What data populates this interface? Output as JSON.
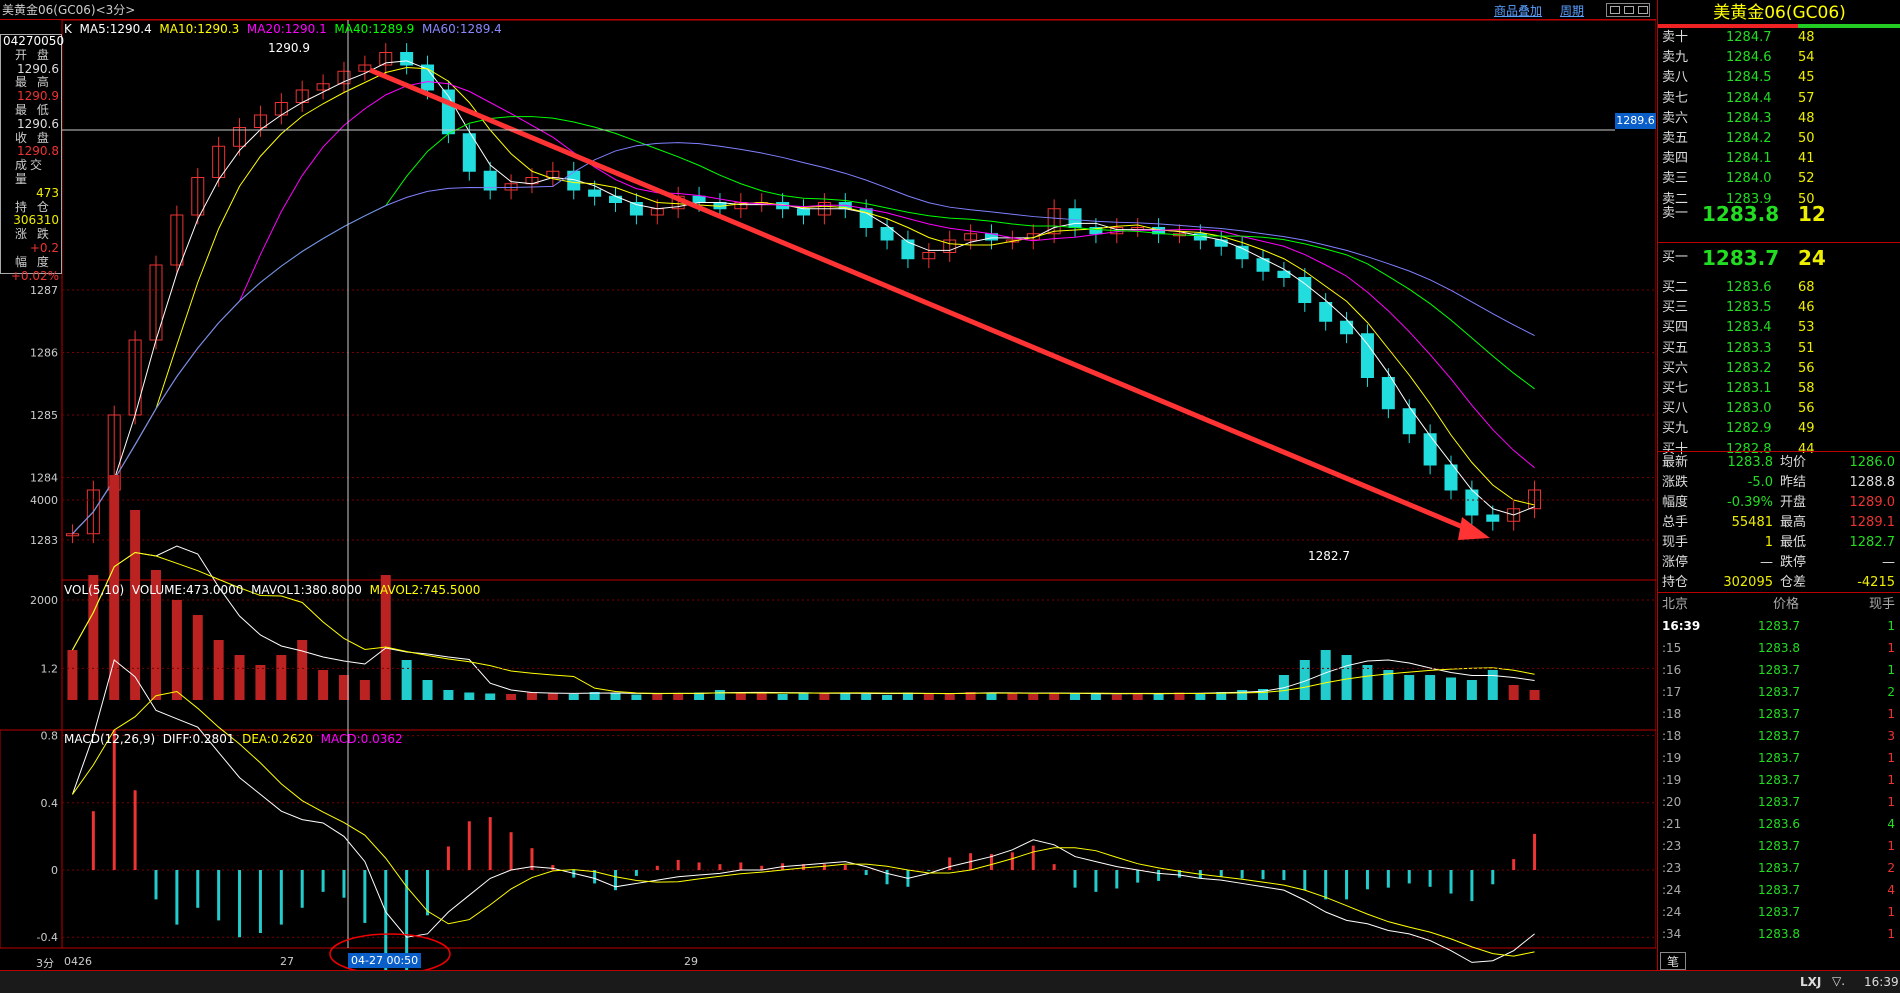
{
  "title": "美黄金06(GC06)<3分>",
  "toolbar": {
    "overlay_link": "商品叠加",
    "period_link": "周期"
  },
  "info_box": {
    "date": "04270050",
    "rows": [
      {
        "label": "开 盘",
        "value": "1290.6",
        "color": "#ddd"
      },
      {
        "label": "最 高",
        "value": "1290.9",
        "color": "#e33"
      },
      {
        "label": "最 低",
        "value": "1290.6",
        "color": "#ddd"
      },
      {
        "label": "收 盘",
        "value": "1290.8",
        "color": "#e33"
      },
      {
        "label": "成交量",
        "value": "473",
        "color": "#ee0"
      },
      {
        "label": "持 仓",
        "value": "306310",
        "color": "#ee0"
      },
      {
        "label": "涨 跌",
        "value": "+0.2",
        "color": "#e33"
      },
      {
        "label": "幅 度",
        "value": "+0.02%",
        "color": "#e33"
      }
    ]
  },
  "ma_legend": {
    "k": "K",
    "ma5": "MA5:1290.4",
    "ma10": "MA10:1290.3",
    "ma20": "MA20:1290.1",
    "ma40": "MA40:1289.9",
    "ma60": "MA60:1289.4",
    "colors": {
      "ma5": "#ffffff",
      "ma10": "#ffff00",
      "ma20": "#ff00ff",
      "ma40": "#00ff00",
      "ma60": "#8080ff"
    }
  },
  "price_axis": {
    "ticks": [
      "1287",
      "1286",
      "1285",
      "1284",
      "1283"
    ],
    "crosshair_value": "1289.6"
  },
  "annotations": {
    "high_label": "1290.9",
    "low_label": "1282.7"
  },
  "vol_legend": {
    "name": "VOL(5,10)",
    "volume": "VOLUME:473.0000",
    "mavol1": "MAVOL1:380.8000",
    "mavol2": "MAVOL2:745.5000"
  },
  "vol_axis": [
    "4000",
    "2000"
  ],
  "macd_legend": {
    "name": "MACD(12,26,9)",
    "diff": "DIFF:0.2801",
    "dea": "DEA:0.2620",
    "macd": "MACD:0.0362"
  },
  "macd_axis": [
    "1.2",
    "0.8",
    "0.4",
    "0",
    "-0.4"
  ],
  "time_axis": {
    "period": "3分",
    "labels": [
      "0426",
      "27",
      "29"
    ],
    "crosshair_time": "04-27 00:50"
  },
  "quote": {
    "name": "美黄金06(GC06)",
    "asks": [
      {
        "label": "卖十",
        "price": "1284.7",
        "vol": "48"
      },
      {
        "label": "卖九",
        "price": "1284.6",
        "vol": "54"
      },
      {
        "label": "卖八",
        "price": "1284.5",
        "vol": "45"
      },
      {
        "label": "卖七",
        "price": "1284.4",
        "vol": "57"
      },
      {
        "label": "卖六",
        "price": "1284.3",
        "vol": "48"
      },
      {
        "label": "卖五",
        "price": "1284.2",
        "vol": "50"
      },
      {
        "label": "卖四",
        "price": "1284.1",
        "vol": "41"
      },
      {
        "label": "卖三",
        "price": "1284.0",
        "vol": "52"
      },
      {
        "label": "卖二",
        "price": "1283.9",
        "vol": "50"
      },
      {
        "label": "卖一",
        "price": "1283.8",
        "vol": "12"
      }
    ],
    "bids": [
      {
        "label": "买一",
        "price": "1283.7",
        "vol": "24"
      },
      {
        "label": "买二",
        "price": "1283.6",
        "vol": "68"
      },
      {
        "label": "买三",
        "price": "1283.5",
        "vol": "46"
      },
      {
        "label": "买四",
        "price": "1283.4",
        "vol": "53"
      },
      {
        "label": "买五",
        "price": "1283.3",
        "vol": "51"
      },
      {
        "label": "买六",
        "price": "1283.2",
        "vol": "56"
      },
      {
        "label": "买七",
        "price": "1283.1",
        "vol": "58"
      },
      {
        "label": "买八",
        "price": "1283.0",
        "vol": "56"
      },
      {
        "label": "买九",
        "price": "1282.9",
        "vol": "49"
      },
      {
        "label": "买十",
        "price": "1282.8",
        "vol": "44"
      }
    ],
    "stats": [
      {
        "l1": "最新",
        "v1": "1283.8",
        "c1": "#2d2",
        "l2": "均价",
        "v2": "1286.0",
        "c2": "#2d2"
      },
      {
        "l1": "涨跌",
        "v1": "-5.0",
        "c1": "#2d2",
        "l2": "昨结",
        "v2": "1288.8",
        "c2": "#ddd"
      },
      {
        "l1": "幅度",
        "v1": "-0.39%",
        "c1": "#2d2",
        "l2": "开盘",
        "v2": "1289.0",
        "c2": "#e33"
      },
      {
        "l1": "总手",
        "v1": "55481",
        "c1": "#ee0",
        "l2": "最高",
        "v2": "1289.1",
        "c2": "#e33"
      },
      {
        "l1": "现手",
        "v1": "1",
        "c1": "#ee0",
        "l2": "最低",
        "v2": "1282.7",
        "c2": "#2d2"
      },
      {
        "l1": "涨停",
        "v1": "—",
        "c1": "#ddd",
        "l2": "跌停",
        "v2": "—",
        "c2": "#ddd"
      },
      {
        "l1": "持仓",
        "v1": "302095",
        "c1": "#ee0",
        "l2": "仓差",
        "v2": "-4215",
        "c2": "#ee0"
      }
    ],
    "ticks_header": {
      "time": "北京",
      "price": "价格",
      "vol": "现手"
    },
    "ticks": [
      {
        "t": "16:39",
        "p": "1283.7",
        "v": "1",
        "vc": "#2d2"
      },
      {
        "t": ":15",
        "p": "1283.8",
        "v": "1",
        "vc": "#e33"
      },
      {
        "t": ":16",
        "p": "1283.7",
        "v": "1",
        "vc": "#2d2"
      },
      {
        "t": ":17",
        "p": "1283.7",
        "v": "2",
        "vc": "#2d2"
      },
      {
        "t": ":18",
        "p": "1283.7",
        "v": "1",
        "vc": "#e33"
      },
      {
        "t": ":18",
        "p": "1283.7",
        "v": "3",
        "vc": "#e33"
      },
      {
        "t": ":19",
        "p": "1283.7",
        "v": "1",
        "vc": "#e33"
      },
      {
        "t": ":19",
        "p": "1283.7",
        "v": "1",
        "vc": "#e33"
      },
      {
        "t": ":20",
        "p": "1283.7",
        "v": "1",
        "vc": "#e33"
      },
      {
        "t": ":21",
        "p": "1283.6",
        "v": "4",
        "vc": "#2d2"
      },
      {
        "t": ":23",
        "p": "1283.7",
        "v": "1",
        "vc": "#e33"
      },
      {
        "t": ":23",
        "p": "1283.7",
        "v": "2",
        "vc": "#e33"
      },
      {
        "t": ":24",
        "p": "1283.7",
        "v": "4",
        "vc": "#e33"
      },
      {
        "t": ":24",
        "p": "1283.7",
        "v": "1",
        "vc": "#e33"
      },
      {
        "t": ":34",
        "p": "1283.8",
        "v": "1",
        "vc": "#e33"
      }
    ],
    "bottom_tab": "笔"
  },
  "statusbar": {
    "lxj": "LXJ",
    "time": "16:39"
  },
  "chart_data": {
    "type": "line",
    "title": "",
    "price": [
      1283.1,
      1283.8,
      1285.0,
      1286.2,
      1287.4,
      1288.2,
      1288.8,
      1289.3,
      1289.6,
      1289.8,
      1290.0,
      1290.2,
      1290.3,
      1290.5,
      1290.6,
      1290.8,
      1290.6,
      1290.2,
      1289.5,
      1288.9,
      1288.6,
      1288.7,
      1288.8,
      1288.9,
      1288.6,
      1288.5,
      1288.4,
      1288.2,
      1288.3,
      1288.5,
      1288.4,
      1288.3,
      1288.4,
      1288.4,
      1288.3,
      1288.2,
      1288.4,
      1288.3,
      1288.0,
      1287.8,
      1287.5,
      1287.6,
      1287.8,
      1287.9,
      1287.8,
      1287.8,
      1287.9,
      1288.3,
      1288.0,
      1287.9,
      1288.0,
      1288.0,
      1287.9,
      1287.9,
      1287.8,
      1287.7,
      1287.5,
      1287.3,
      1287.2,
      1286.8,
      1286.5,
      1286.3,
      1285.6,
      1285.1,
      1284.7,
      1284.2,
      1283.8,
      1283.4,
      1283.3,
      1283.5,
      1283.8
    ],
    "volume": [
      1000,
      2500,
      4500,
      3800,
      2600,
      2000,
      1700,
      1200,
      900,
      700,
      900,
      1200,
      600,
      500,
      400,
      2500,
      800,
      400,
      200,
      150,
      130,
      120,
      150,
      140,
      120,
      160,
      130,
      110,
      120,
      140,
      150,
      200,
      140,
      130,
      120,
      130,
      150,
      140,
      120,
      100,
      150,
      140,
      130,
      160,
      150,
      130,
      120,
      140,
      130,
      120,
      110,
      140,
      130,
      150,
      140,
      160,
      200,
      220,
      500,
      800,
      1000,
      900,
      700,
      600,
      500,
      500,
      450,
      400,
      600,
      300,
      200
    ],
    "macd_diff": [
      0.45,
      0.8,
      1.25,
      1.15,
      0.95,
      0.9,
      0.85,
      0.7,
      0.55,
      0.45,
      0.35,
      0.3,
      0.28,
      0.2,
      0.05,
      -0.25,
      -0.4,
      -0.38,
      -0.25,
      -0.15,
      -0.05,
      0.0,
      0.02,
      0.01,
      -0.02,
      -0.05,
      -0.1,
      -0.08,
      -0.06,
      -0.04,
      -0.03,
      -0.02,
      0.0,
      0.0,
      0.02,
      0.03,
      0.04,
      0.05,
      0.02,
      -0.02,
      -0.05,
      -0.02,
      0.02,
      0.05,
      0.08,
      0.12,
      0.18,
      0.15,
      0.08,
      0.05,
      0.02,
      0.0,
      -0.02,
      -0.03,
      -0.05,
      -0.06,
      -0.08,
      -0.1,
      -0.12,
      -0.18,
      -0.25,
      -0.3,
      -0.32,
      -0.36,
      -0.38,
      -0.42,
      -0.48,
      -0.55,
      -0.54,
      -0.48,
      -0.38
    ],
    "ylim_price": [
      1282.7,
      1290.9
    ],
    "xlabels": [
      "0426",
      "27",
      "29"
    ]
  }
}
